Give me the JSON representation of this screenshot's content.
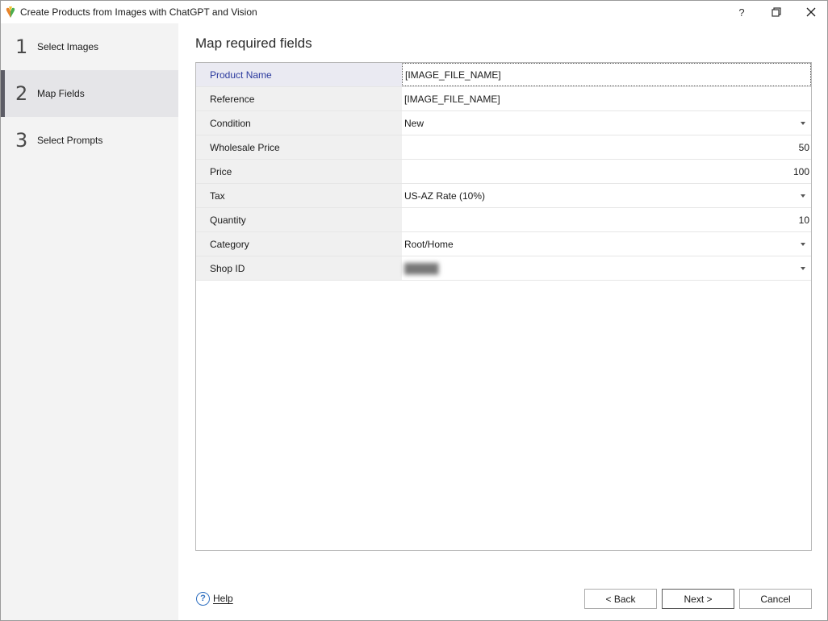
{
  "window": {
    "title": "Create Products from Images with ChatGPT and Vision",
    "controls": {
      "help": "?",
      "restore_icon": "restore-icon",
      "close_icon": "close-icon"
    }
  },
  "sidebar": {
    "steps": [
      {
        "number": "1",
        "label": "Select Images",
        "active": false
      },
      {
        "number": "2",
        "label": "Map Fields",
        "active": true
      },
      {
        "number": "3",
        "label": "Select Prompts",
        "active": false
      }
    ]
  },
  "main": {
    "heading": "Map required fields",
    "fields": [
      {
        "label": "Product Name",
        "value": "[IMAGE_FILE_NAME]",
        "kind": "text",
        "selected": true
      },
      {
        "label": "Reference",
        "value": "[IMAGE_FILE_NAME]",
        "kind": "text"
      },
      {
        "label": "Condition",
        "value": "New",
        "kind": "dropdown"
      },
      {
        "label": "Wholesale Price",
        "value": "50",
        "kind": "number"
      },
      {
        "label": "Price",
        "value": "100",
        "kind": "number"
      },
      {
        "label": "Tax",
        "value": "US-AZ Rate (10%)",
        "kind": "dropdown"
      },
      {
        "label": "Quantity",
        "value": "10",
        "kind": "number"
      },
      {
        "label": "Category",
        "value": "Root/Home",
        "kind": "dropdown"
      },
      {
        "label": "Shop ID",
        "value": "",
        "kind": "dropdown",
        "blurred": true
      }
    ]
  },
  "footer": {
    "help_label": "Help",
    "back_label": "< Back",
    "next_label": "Next >",
    "cancel_label": "Cancel"
  },
  "colors": {
    "selected_label_text": "#2b3a9e",
    "sidebar_bg": "#f3f3f3",
    "active_step_bg": "#e5e5e8",
    "help_icon": "#2f6fc0"
  }
}
